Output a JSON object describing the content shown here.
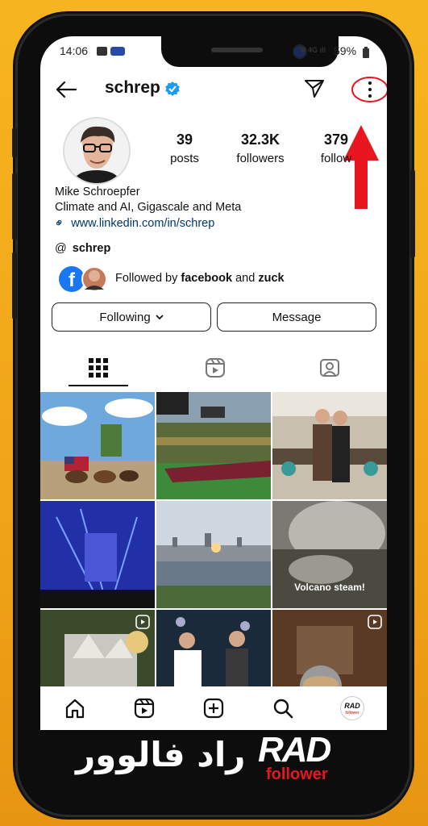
{
  "status": {
    "time": "14:06",
    "battery": "59%"
  },
  "header": {
    "username": "schrep"
  },
  "stats": [
    {
      "value": "39",
      "label": "posts"
    },
    {
      "value": "32.3K",
      "label": "followers"
    },
    {
      "value": "379",
      "label": "follow"
    }
  ],
  "bio": {
    "name": "Mike Schroepfer",
    "description": "Climate and AI, Gigascale and Meta",
    "link": "www.linkedin.com/in/schrep",
    "threads_handle": "schrep",
    "followed_by_prefix": "Followed by",
    "followed_by_1": "facebook",
    "followed_by_and": "and",
    "followed_by_2": "zuck"
  },
  "actions": {
    "following": "Following",
    "message": "Message"
  },
  "grid": {
    "volcano_caption": "Volcano steam!"
  },
  "nav_avatar_text": "RAD",
  "nav_avatar_sub": "follower",
  "brand": {
    "rad": "RAD",
    "follower": "follower",
    "arabic": "راد فالوور"
  },
  "colors": {
    "verified": "#1d9bf0",
    "link": "#00376b",
    "annotation": "#e8161e",
    "facebook": "#1877f2"
  },
  "icons": [
    "back-arrow-icon",
    "verified-badge-icon",
    "send-icon",
    "more-options-icon",
    "link-icon",
    "threads-icon",
    "chevron-down-icon",
    "grid-icon",
    "reels-icon",
    "tagged-icon",
    "reel-badge-icon",
    "home-icon",
    "reels-nav-icon",
    "create-icon",
    "search-icon"
  ]
}
